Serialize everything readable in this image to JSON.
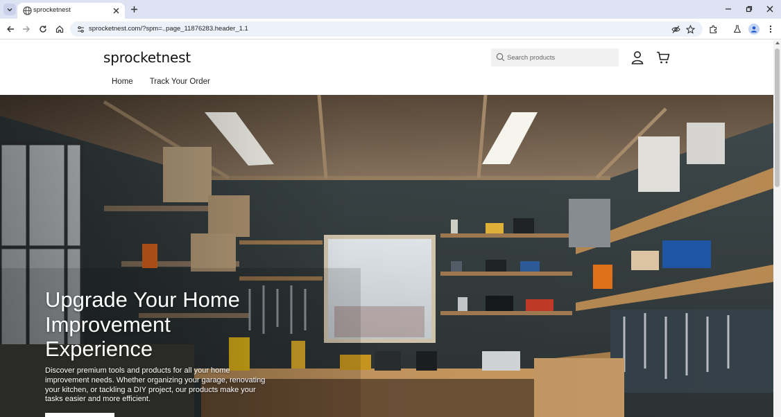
{
  "browser": {
    "tab_title": "sprocketnest",
    "url": "sprocketnest.com/?spm=..page_11876283.header_1.1"
  },
  "site": {
    "logo": "sprocketnest",
    "search_placeholder": "Search products",
    "nav": [
      {
        "label": "Home"
      },
      {
        "label": "Track Your Order"
      }
    ]
  },
  "hero": {
    "title": "Upgrade Your Home Improvement Experience",
    "description": "Discover premium tools and products for all your home improvement needs. Whether organizing your garage, renovating your kitchen, or tackling a DIY project, our products make your tasks easier and more efficient.",
    "cta_label": ""
  },
  "icons": {
    "tab_list": "chevron-down-icon",
    "favicon": "globe-icon",
    "tab_close": "close-icon",
    "new_tab": "plus-icon",
    "back": "back-arrow-icon",
    "forward": "forward-arrow-icon",
    "reload": "reload-icon",
    "home": "home-icon",
    "site_info": "tune-icon",
    "eye_off": "eye-off-icon",
    "bookmark": "star-icon",
    "extensions": "puzzle-icon",
    "labs": "flask-icon",
    "profile": "avatar-icon",
    "menu": "kebab-menu-icon",
    "search": "search-icon",
    "account": "user-icon",
    "cart": "cart-icon"
  },
  "colors": {
    "tabstrip": "#dde3f3",
    "omnibox": "#edf1f9",
    "search_bg": "#f1f1f1",
    "hero_text": "#ffffff"
  }
}
